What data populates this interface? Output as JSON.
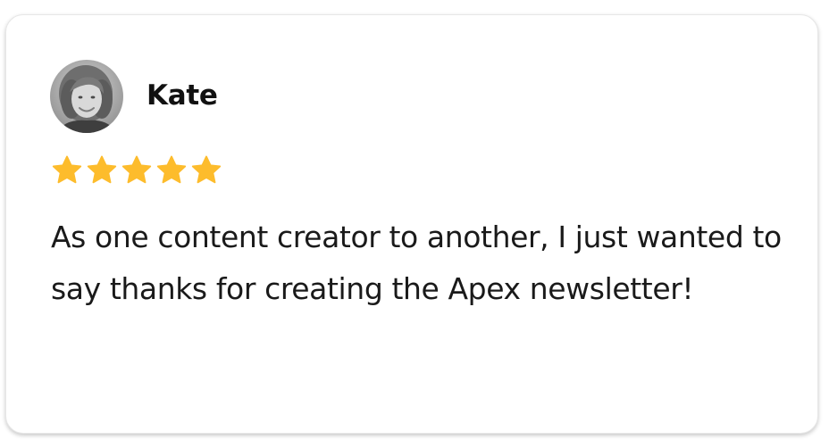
{
  "review": {
    "author_name": "Kate",
    "avatar_icon": "profile-photo",
    "rating": 5,
    "rating_max": 5,
    "star_color": "#FDBC2C",
    "text": "As one content creator to another, I just wanted to say thanks for creating the Apex newsletter!"
  }
}
